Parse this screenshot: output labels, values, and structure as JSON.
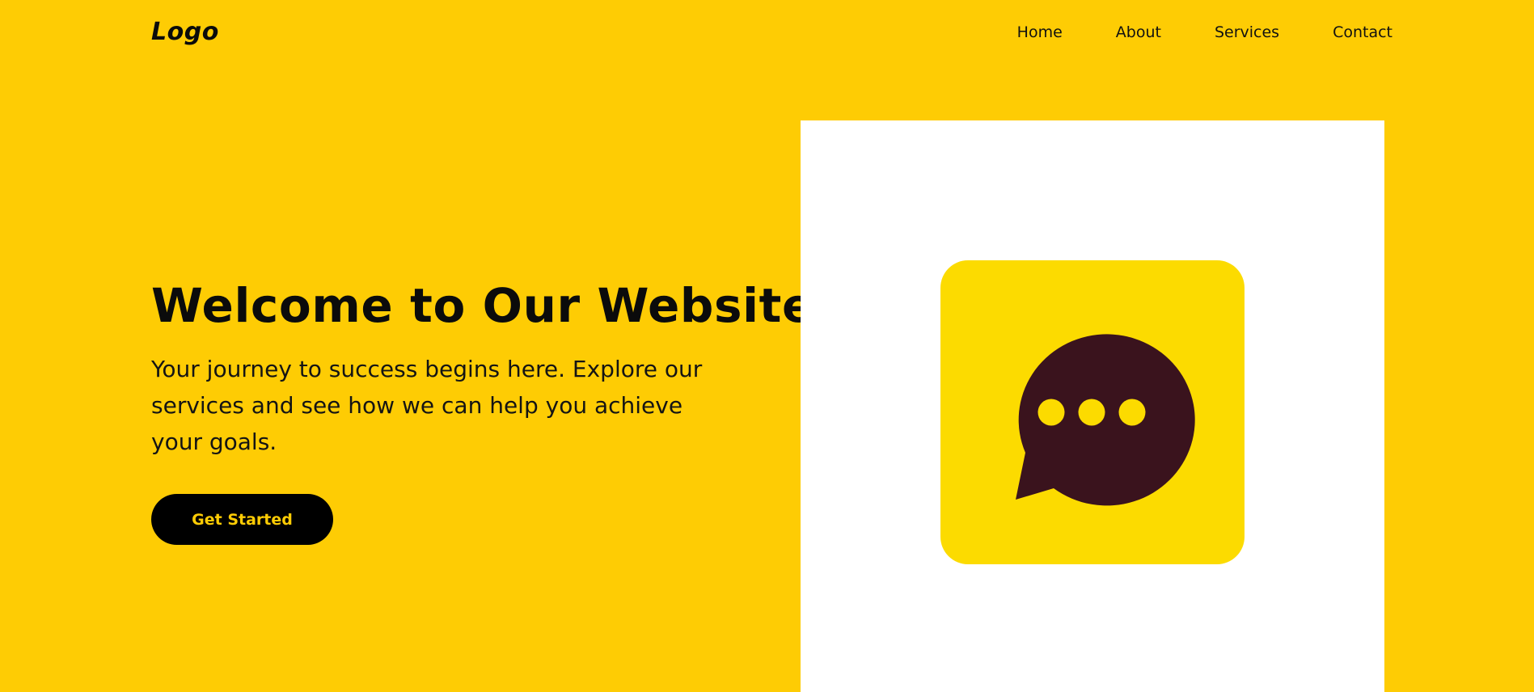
{
  "header": {
    "logo_text": "Logo",
    "nav": [
      {
        "label": "Home"
      },
      {
        "label": "About"
      },
      {
        "label": "Services"
      },
      {
        "label": "Contact"
      }
    ]
  },
  "hero": {
    "title": "Welcome to Our Website",
    "subtitle": "Your journey to success begins here. Explore our services and see how we can help you achieve your goals.",
    "cta_label": "Get Started"
  },
  "image": {
    "icon": "chat-bubble-icon"
  },
  "colors": {
    "background": "#FECC04",
    "text": "#0B0B0B",
    "button_bg": "#000000",
    "button_text": "#FECC04",
    "card_bg": "#FFFFFF",
    "icon_bg": "#FCDB00",
    "bubble": "#3A131D"
  }
}
